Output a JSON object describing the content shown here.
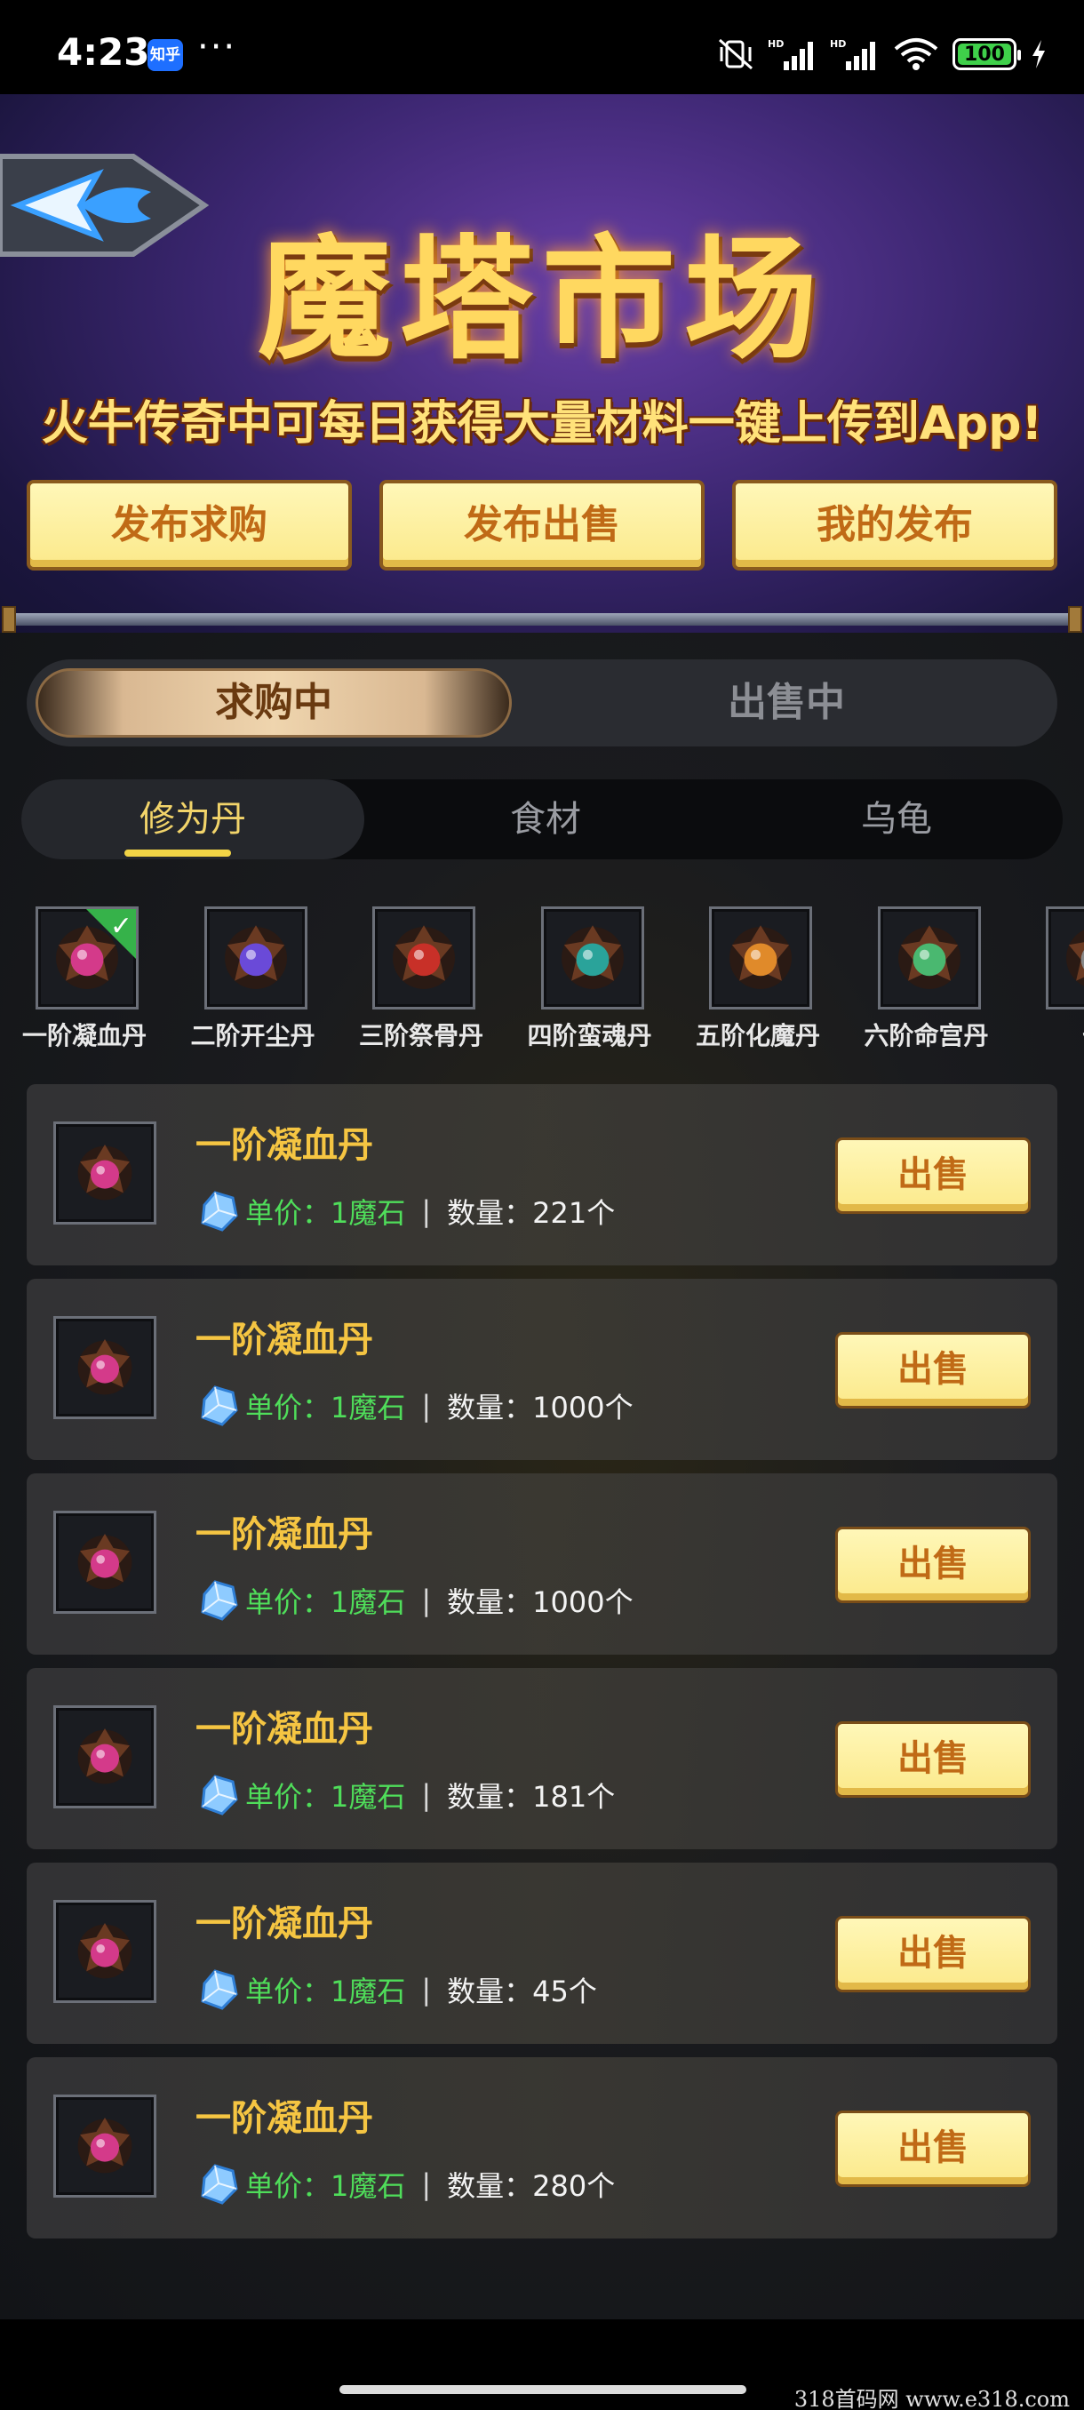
{
  "status_bar": {
    "time": "4:23",
    "app_badge": "知乎",
    "more": "···",
    "battery": "100",
    "battery_level": 1.0
  },
  "header": {
    "title": "魔塔市场",
    "subtitle": "火牛传奇中可每日获得大量材料一键上传到App!",
    "buttons": [
      "发布求购",
      "发布出售",
      "我的发布"
    ]
  },
  "segment": {
    "active": "求购中",
    "inactive": "出售中"
  },
  "tabs": [
    "修为丹",
    "食材",
    "乌龟"
  ],
  "items": [
    {
      "label": "一阶凝血丹",
      "color": "#d43a8a"
    },
    {
      "label": "二阶开尘丹",
      "color": "#6a4ad8"
    },
    {
      "label": "三阶祭骨丹",
      "color": "#c83028"
    },
    {
      "label": "四阶蛮魂丹",
      "color": "#2aa39a"
    },
    {
      "label": "五阶化魔丹",
      "color": "#e08a2a"
    },
    {
      "label": "六阶命宫丹",
      "color": "#4ab870"
    },
    {
      "label": "七",
      "color": "#888888"
    }
  ],
  "listings": [
    {
      "name": "一阶凝血丹",
      "price": "单价：1魔石",
      "qty": "数量：221个",
      "button": "出售"
    },
    {
      "name": "一阶凝血丹",
      "price": "单价：1魔石",
      "qty": "数量：1000个",
      "button": "出售"
    },
    {
      "name": "一阶凝血丹",
      "price": "单价：1魔石",
      "qty": "数量：1000个",
      "button": "出售"
    },
    {
      "name": "一阶凝血丹",
      "price": "单价：1魔石",
      "qty": "数量：181个",
      "button": "出售"
    },
    {
      "name": "一阶凝血丹",
      "price": "单价：1魔石",
      "qty": "数量：45个",
      "button": "出售"
    },
    {
      "name": "一阶凝血丹",
      "price": "单价：1魔石",
      "qty": "数量：280个",
      "button": "出售"
    }
  ],
  "separator": "|",
  "watermark": "318首码网  www.e318.com"
}
